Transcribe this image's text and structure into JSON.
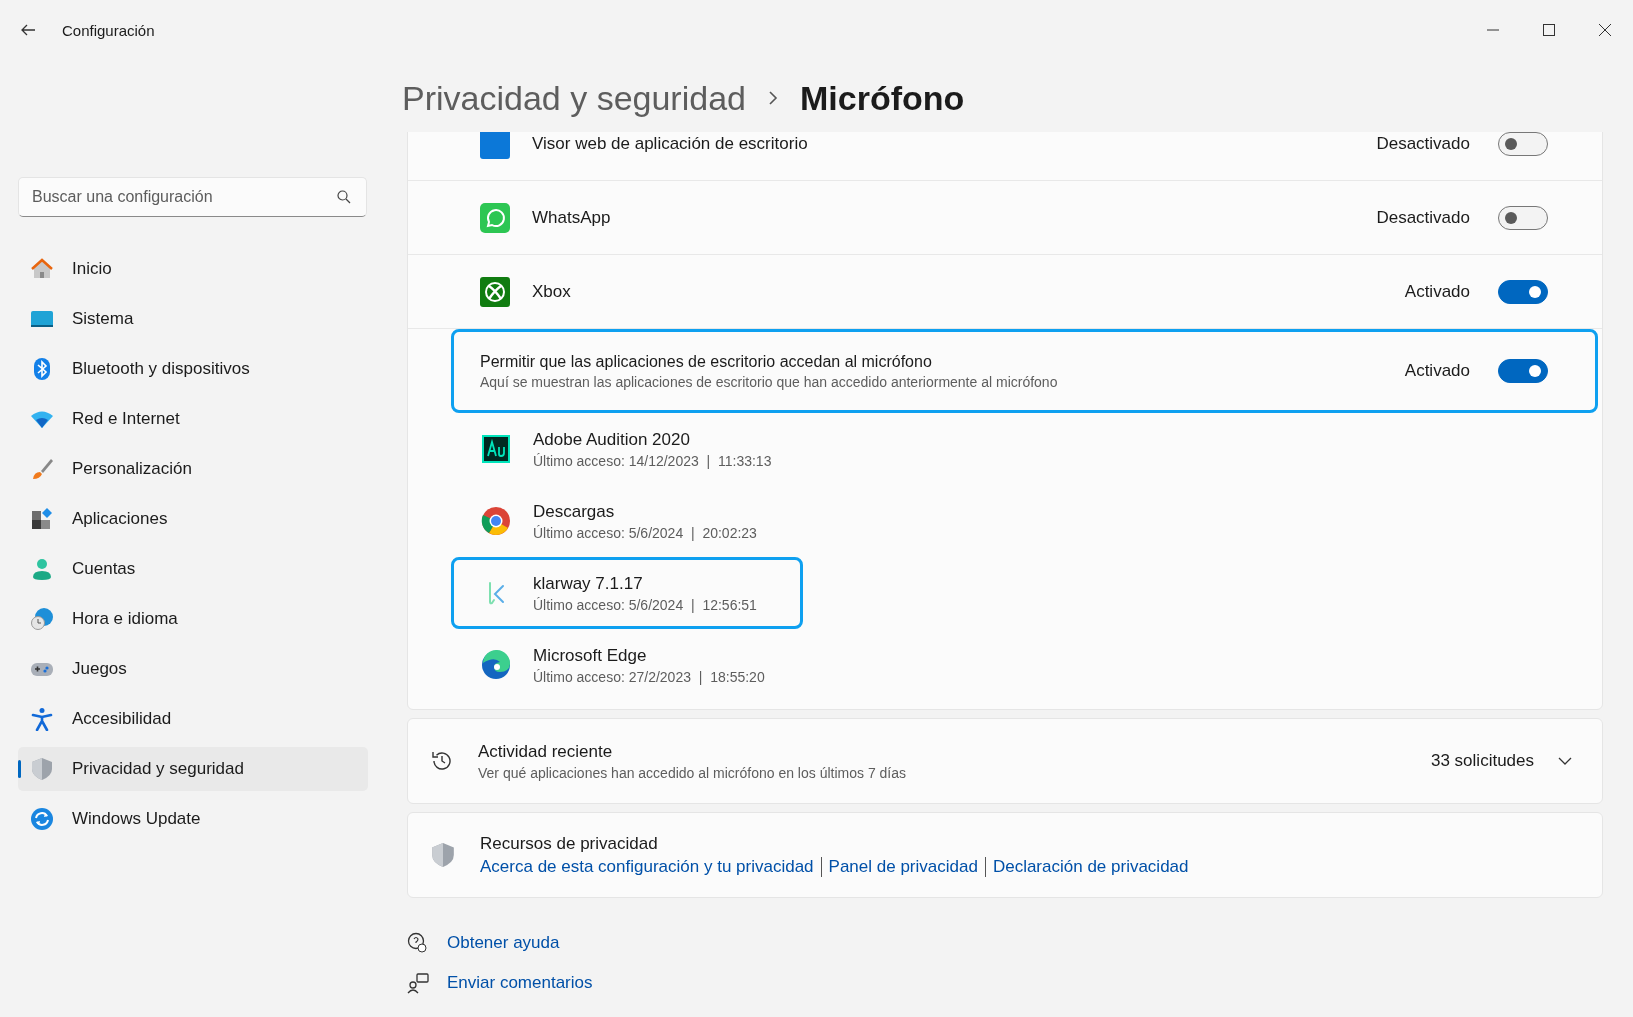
{
  "window": {
    "title": "Configuración"
  },
  "search": {
    "placeholder": "Buscar una configuración"
  },
  "nav": [
    {
      "label": "Inicio",
      "selected": false
    },
    {
      "label": "Sistema",
      "selected": false
    },
    {
      "label": "Bluetooth y dispositivos",
      "selected": false
    },
    {
      "label": "Red e Internet",
      "selected": false
    },
    {
      "label": "Personalización",
      "selected": false
    },
    {
      "label": "Aplicaciones",
      "selected": false
    },
    {
      "label": "Cuentas",
      "selected": false
    },
    {
      "label": "Hora e idioma",
      "selected": false
    },
    {
      "label": "Juegos",
      "selected": false
    },
    {
      "label": "Accesibilidad",
      "selected": false
    },
    {
      "label": "Privacidad y seguridad",
      "selected": true
    },
    {
      "label": "Windows Update",
      "selected": false
    }
  ],
  "breadcrumb": {
    "parent": "Privacidad y seguridad",
    "current": "Micrófono"
  },
  "apps": [
    {
      "name": "Visor web de aplicación de escritorio",
      "status": "Desactivado",
      "on": false
    },
    {
      "name": "WhatsApp",
      "status": "Desactivado",
      "on": false
    },
    {
      "name": "Xbox",
      "status": "Activado",
      "on": true
    }
  ],
  "desktop_access": {
    "title": "Permitir que las aplicaciones de escritorio accedan al micrófono",
    "description": "Aquí se muestran las aplicaciones de escritorio que han accedido anteriormente al micrófono",
    "status": "Activado",
    "on": true,
    "highlighted": true
  },
  "desktop_apps": [
    {
      "name": "Adobe Audition 2020",
      "last_access": "Último acceso: 14/12/2023  |  11:33:13",
      "highlighted": false
    },
    {
      "name": "Descargas",
      "last_access": "Último acceso: 5/6/2024  |  20:02:23",
      "highlighted": false
    },
    {
      "name": "klarway 7.1.17",
      "last_access": "Último acceso: 5/6/2024  |  12:56:51",
      "highlighted": true
    },
    {
      "name": "Microsoft Edge",
      "last_access": "Último acceso: 27/2/2023  |  18:55:20",
      "highlighted": false
    }
  ],
  "recent_activity": {
    "title": "Actividad reciente",
    "description": "Ver qué aplicaciones han accedido al micrófono en los últimos 7 días",
    "count": "33 solicitudes",
    "expanded": false
  },
  "privacy_resources": {
    "title": "Recursos de privacidad",
    "links": [
      "Acerca de esta configuración y tu privacidad",
      "Panel de privacidad",
      "Declaración de privacidad"
    ]
  },
  "footer_links": [
    "Obtener ayuda",
    "Enviar comentarios"
  ]
}
